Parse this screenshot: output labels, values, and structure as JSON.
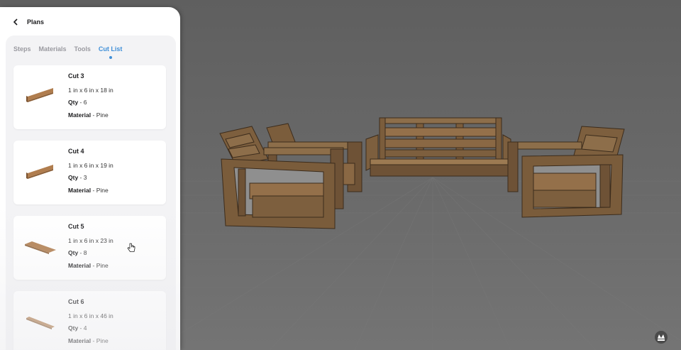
{
  "header": {
    "back_label": "Plans"
  },
  "tabs": [
    {
      "label": "Steps",
      "active": false
    },
    {
      "label": "Materials",
      "active": false
    },
    {
      "label": "Tools",
      "active": false
    },
    {
      "label": "Cut List",
      "active": true
    }
  ],
  "cut_list": [
    {
      "title": "Cut 3",
      "dims": "1 in x 6 in x 18 in",
      "qty_label": "Qty",
      "qty": "6",
      "material_label": "Material",
      "material": "Pine"
    },
    {
      "title": "Cut 4",
      "dims": "1 in x 6 in x 19 in",
      "qty_label": "Qty",
      "qty": "3",
      "material_label": "Material",
      "material": "Pine"
    },
    {
      "title": "Cut 5",
      "dims": "1 in x 6 in x 23 in",
      "qty_label": "Qty",
      "qty": "8",
      "material_label": "Material",
      "material": "Pine"
    },
    {
      "title": "Cut 6",
      "dims": "1 in x 6 in x 46 in",
      "qty_label": "Qty",
      "qty": "4",
      "material_label": "Material",
      "material": "Pine"
    }
  ],
  "colors": {
    "accent": "#3f8fd8",
    "wood": "#8a6a44",
    "viewport_bg": "#646464"
  },
  "icons": {
    "back": "chevron-left-icon",
    "cursor": "hand-pointer-icon",
    "watermark": "logo-icon"
  }
}
